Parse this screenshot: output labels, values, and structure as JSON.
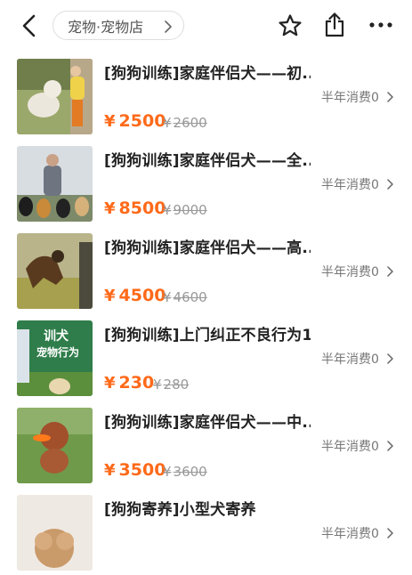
{
  "header": {
    "back_icon": "back-arrow-icon",
    "breadcrumb": "宠物·宠物店",
    "icons": [
      "star-icon",
      "share-icon",
      "more-icon"
    ]
  },
  "colors": {
    "price": "#ff6a1a",
    "muted": "#999999"
  },
  "items": [
    {
      "title": "[狗狗训练]家庭伴侣犬——初...",
      "sales": "半年消费0",
      "price_symbol": "¥",
      "price": "2500",
      "orig_symbol": "¥",
      "orig": "2600"
    },
    {
      "title": "[狗狗训练]家庭伴侣犬——全...",
      "sales": "半年消费0",
      "price_symbol": "¥",
      "price": "8500",
      "orig_symbol": "¥",
      "orig": "9000"
    },
    {
      "title": "[狗狗训练]家庭伴侣犬——高...",
      "sales": "半年消费0",
      "price_symbol": "¥",
      "price": "4500",
      "orig_symbol": "¥",
      "orig": "4600"
    },
    {
      "title": "[狗狗训练]上门纠正不良行为1...",
      "sales": "半年消费0",
      "price_symbol": "¥",
      "price": "230",
      "orig_symbol": "¥",
      "orig": "280",
      "thumb_text": [
        "训犬",
        "宠物行为"
      ]
    },
    {
      "title": "[狗狗训练]家庭伴侣犬——中...",
      "sales": "半年消费0",
      "price_symbol": "¥",
      "price": "3500",
      "orig_symbol": "¥",
      "orig": "3600"
    },
    {
      "title": "[狗狗寄养]小型犬寄养",
      "sales": "半年消费0"
    }
  ]
}
